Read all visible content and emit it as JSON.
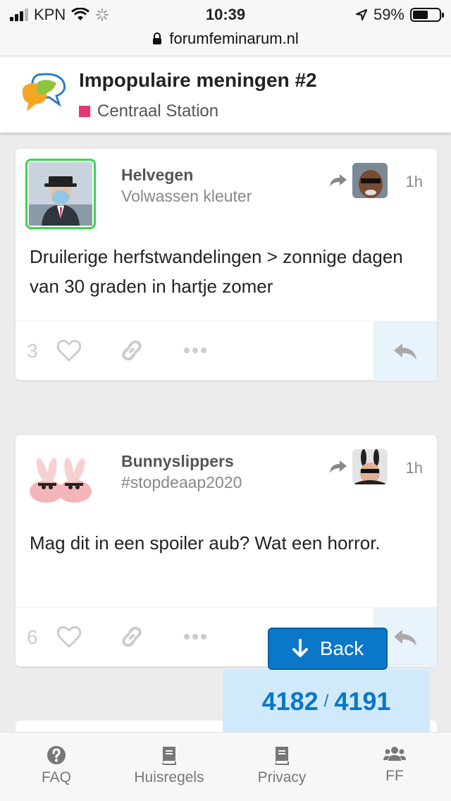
{
  "status": {
    "carrier": "KPN",
    "time": "10:39",
    "battery": "59%",
    "battery_level": 0.59,
    "url": "forumfeminarum.nl"
  },
  "topic": {
    "title": "Impopulaire meningen #2",
    "category": "Centraal Station",
    "category_color": "#e8356f"
  },
  "posts": [
    {
      "username": "Helvegen",
      "user_title": "Volwassen kleuter",
      "time": "1h",
      "body": "Druilerige herfstwandelingen > zonnige dagen van 30 graden in hartje zomer",
      "likes": "3"
    },
    {
      "username": "Bunnyslippers",
      "user_title": "#stopdeaap2020",
      "time": "1h",
      "body": "Mag dit in een spoiler aub? Wat een horror.",
      "likes": "6"
    }
  ],
  "back_label": "Back",
  "progress": {
    "current": "4182",
    "total": "4191"
  },
  "nav": [
    {
      "label": "FAQ",
      "icon": "question-circle-icon"
    },
    {
      "label": "Huisregels",
      "icon": "book-icon"
    },
    {
      "label": "Privacy",
      "icon": "book-icon"
    },
    {
      "label": "FF",
      "icon": "users-icon"
    }
  ],
  "colors": {
    "accent": "#0a77c9",
    "online_border": "#3dd44a"
  }
}
